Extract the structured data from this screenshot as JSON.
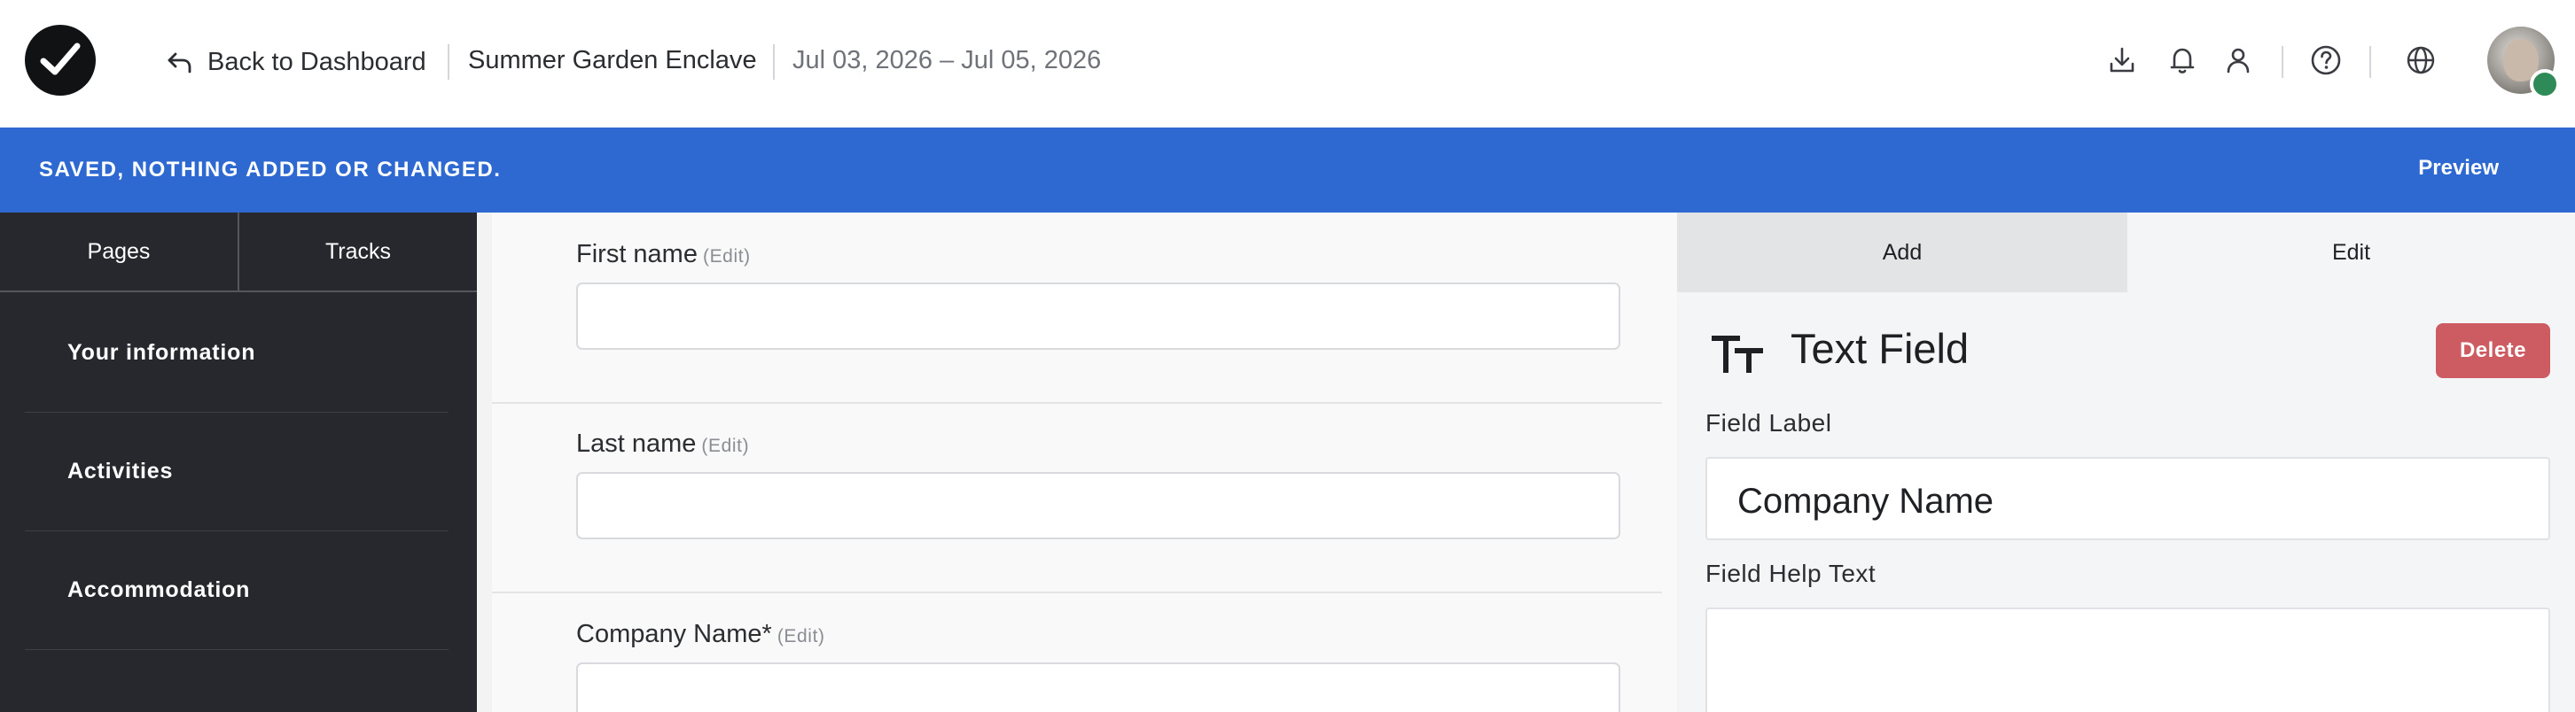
{
  "header": {
    "back_label": "Back to Dashboard",
    "event_name": "Summer Garden Enclave",
    "event_dates": "Jul 03, 2026 – Jul 05, 2026",
    "icons": [
      "download-icon",
      "bell-icon",
      "user-icon",
      "help-icon",
      "globe-icon"
    ]
  },
  "savebar": {
    "message": "SAVED, NOTHING ADDED OR CHANGED.",
    "preview_label": "Preview",
    "color": "#2e69d1"
  },
  "sidebar": {
    "tabs": [
      {
        "label": "Pages"
      },
      {
        "label": "Tracks"
      }
    ],
    "items": [
      {
        "label": "Your information"
      },
      {
        "label": "Activities"
      },
      {
        "label": "Accommodation"
      }
    ]
  },
  "form": {
    "fields": [
      {
        "label": "First name",
        "edit": "(Edit)"
      },
      {
        "label": "Last name",
        "edit": "(Edit)"
      },
      {
        "label": "Company Name*",
        "edit": "(Edit)"
      }
    ]
  },
  "panel": {
    "tabs": [
      {
        "label": "Add"
      },
      {
        "label": "Edit"
      }
    ],
    "title": "Text Field",
    "delete_label": "Delete",
    "field_label_caption": "Field Label",
    "field_label_value": "Company Name",
    "help_text_caption": "Field Help Text",
    "help_text_value": "",
    "delete_color": "#cd5b62"
  }
}
